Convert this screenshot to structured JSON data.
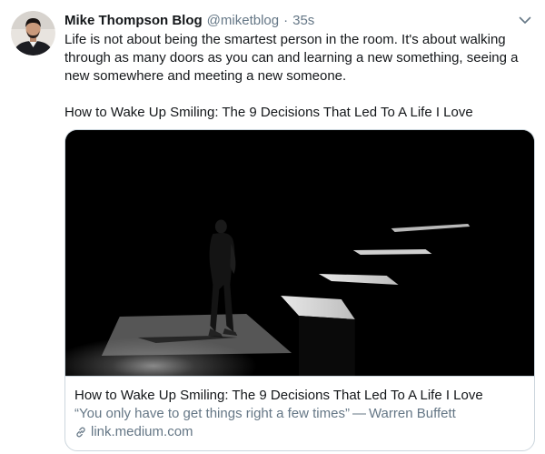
{
  "tweet": {
    "author_name": "Mike Thompson Blog",
    "author_handle": "@miketblog",
    "separator": "·",
    "timestamp": "35s",
    "text_line1": "Life is not about being the smartest person in the room. It's about walking through as many doors as you can and learning a new something, seeing a new somewhere and meeting a new someone.",
    "text_line2": "How to Wake Up Smiling: The 9 Decisions That Led To A Life I Love"
  },
  "card": {
    "title": "How to Wake Up Smiling: The 9 Decisions That Led To A Life I Love",
    "description": "“You only have to get things right a few times” — Warren Buffett",
    "domain": "link.medium.com"
  },
  "icons": {
    "caret": "chevron-down-icon",
    "link": "link-icon"
  },
  "colors": {
    "text": "#14171a",
    "secondary": "#657786",
    "border": "#ccd6dd",
    "accent": "#1da1f2"
  }
}
